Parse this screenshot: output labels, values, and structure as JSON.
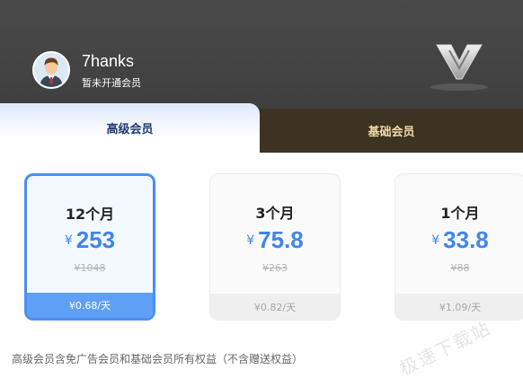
{
  "user": {
    "name": "7hanks",
    "status": "暂未开通会员"
  },
  "tabs": [
    {
      "label": "高级会员",
      "active": true
    },
    {
      "label": "基础会员",
      "active": false
    }
  ],
  "plans": [
    {
      "months": "12个月",
      "currency": "¥",
      "price": "253",
      "original": "¥1048",
      "daily": "¥0.68/天",
      "selected": true
    },
    {
      "months": "3个月",
      "currency": "¥",
      "price": "75.8",
      "original": "¥263",
      "daily": "¥0.82/天",
      "selected": false
    },
    {
      "months": "1个月",
      "currency": "¥",
      "price": "33.8",
      "original": "¥88",
      "daily": "¥1.09/天",
      "selected": false
    }
  ],
  "benefits_note": "高级会员含免广告会员和基础会员所有权益（不含赠送权益）",
  "watermark": "极速下载站",
  "colors": {
    "header_bg": "#434242",
    "accent_blue": "#3f86e8",
    "selected_border": "#4a8ff0",
    "basic_tab_bg": "#3d3322",
    "basic_tab_text": "#f0d9a6"
  },
  "icons": {
    "avatar": "user-avatar-icon",
    "vip": "vip-v-logo-icon"
  }
}
